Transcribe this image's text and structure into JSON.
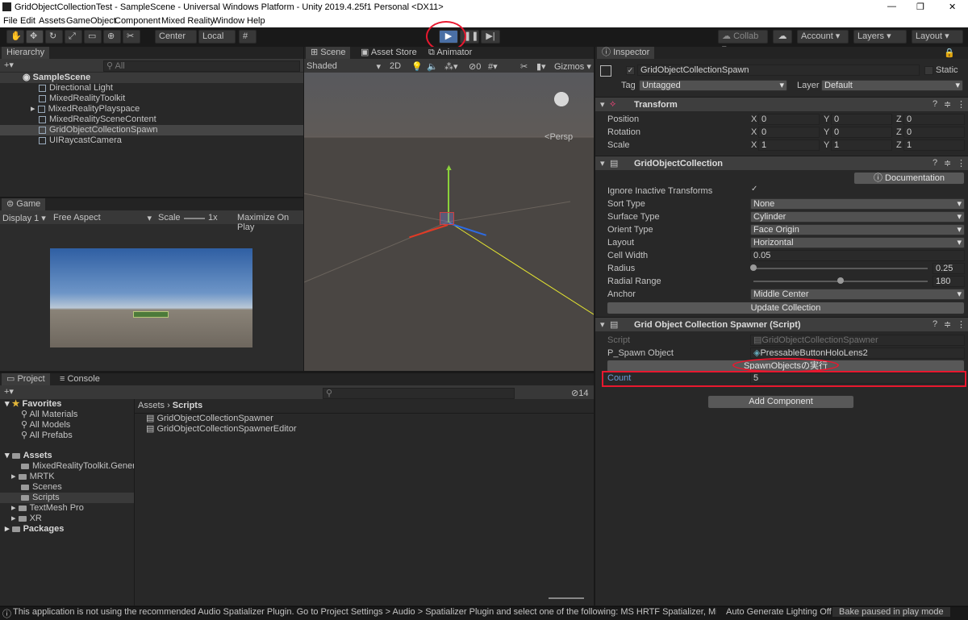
{
  "window": {
    "title": "GridObjectCollectionTest - SampleScene - Universal Windows Platform - Unity 2019.4.25f1 Personal <DX11>",
    "minimize": "—",
    "maximize": "❐",
    "close": "✕"
  },
  "menu": [
    "File",
    "Edit",
    "Assets",
    "GameObject",
    "Component",
    "Mixed Reality",
    "Window",
    "Help"
  ],
  "toolbar": {
    "center": "Center",
    "local": "Local",
    "collab": "Collab",
    "account": "Account",
    "layers": "Layers",
    "layout": "Layout"
  },
  "hierarchy": {
    "tab": "Hierarchy",
    "search_placeholder": "All",
    "scene": "SampleScene",
    "items": [
      "Directional Light",
      "MixedRealityToolkit",
      "MixedRealityPlayspace",
      "MixedRealitySceneContent",
      "GridObjectCollectionSpawn",
      "UIRaycastCamera"
    ]
  },
  "scene_tabs": [
    "Scene",
    "Asset Store",
    "Animator"
  ],
  "scene_toolbar": {
    "shading": "Shaded",
    "twod": "2D",
    "gizmos": "Gizmos",
    "hidden_count": "0",
    "persp": "Persp"
  },
  "game": {
    "tab": "Game",
    "display": "Display 1",
    "aspect": "Free Aspect",
    "scale_label": "Scale",
    "scale_value": "1x",
    "maximize": "Maximize On Play"
  },
  "project": {
    "tabs": [
      "Project",
      "Console"
    ],
    "hidden_count": "14",
    "favorites_label": "Favorites",
    "favorites": [
      "All Materials",
      "All Models",
      "All Prefabs"
    ],
    "assets_label": "Assets",
    "assets": [
      "MixedRealityToolkit.Generated",
      "MRTK",
      "Scenes",
      "Scripts",
      "TextMesh Pro",
      "XR"
    ],
    "packages_label": "Packages",
    "breadcrumb_root": "Assets",
    "breadcrumb_leaf": "Scripts",
    "files": [
      "GridObjectCollectionSpawner",
      "GridObjectCollectionSpawnerEditor"
    ]
  },
  "inspector": {
    "tab": "Inspector",
    "object_name": "GridObjectCollectionSpawn",
    "static_label": "Static",
    "tag_label": "Tag",
    "tag_value": "Untagged",
    "layer_label": "Layer",
    "layer_value": "Default",
    "transform": {
      "title": "Transform",
      "rows": [
        {
          "label": "Position",
          "x": "0",
          "y": "0",
          "z": "0"
        },
        {
          "label": "Rotation",
          "x": "0",
          "y": "0",
          "z": "0"
        },
        {
          "label": "Scale",
          "x": "1",
          "y": "1",
          "z": "1"
        }
      ]
    },
    "goc": {
      "title": "GridObjectCollection",
      "doc_button": "Documentation",
      "ignore_label": "Ignore Inactive Transforms",
      "sort_label": "Sort Type",
      "sort_value": "None",
      "surface_label": "Surface Type",
      "surface_value": "Cylinder",
      "orient_label": "Orient Type",
      "orient_value": "Face Origin",
      "layout_label": "Layout",
      "layout_value": "Horizontal",
      "cell_label": "Cell Width",
      "cell_value": "0.05",
      "radius_label": "Radius",
      "radius_value": "0.25",
      "radius_fraction": 0.0,
      "radial_label": "Radial Range",
      "radial_value": "180",
      "radial_fraction": 0.5,
      "anchor_label": "Anchor",
      "anchor_value": "Middle Center",
      "update_button": "Update Collection"
    },
    "spawner": {
      "title": "Grid Object Collection Spawner (Script)",
      "script_label": "Script",
      "script_value": "GridObjectCollectionSpawner",
      "spawn_label": "P_Spawn Object",
      "spawn_value": "PressableButtonHoloLens2",
      "spawn_button": "SpawnObjectsの実行",
      "count_label": "Count",
      "count_value": "5"
    },
    "add_component": "Add Component"
  },
  "status": {
    "message": "This application is not using the recommended Audio Spatializer Plugin. Go to Project Settings > Audio > Spatializer Plugin and select one of the following: MS HRTF Spatializer, Microsoft Spatializer",
    "lighting": "Auto Generate Lighting Off",
    "bake": "Bake paused in play mode"
  }
}
